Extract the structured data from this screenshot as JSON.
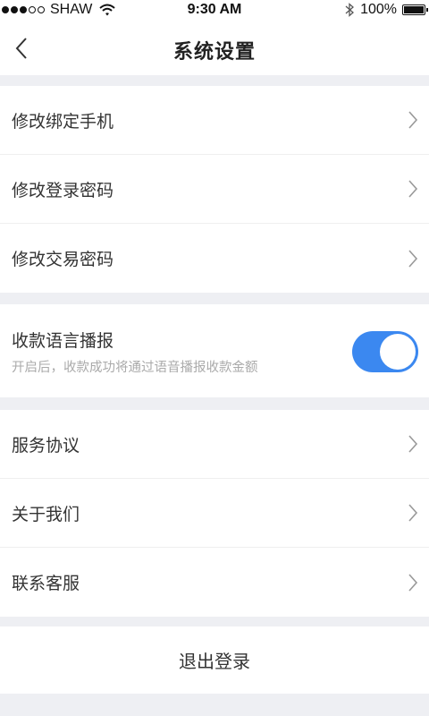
{
  "status_bar": {
    "carrier": "SHAW",
    "time": "9:30 AM",
    "battery": "100%",
    "signal_bars_filled": 3,
    "signal_bars_total": 5
  },
  "nav": {
    "title": "系统设置",
    "back_icon": "chevron-left-icon"
  },
  "group_account": {
    "items": [
      {
        "label": "修改绑定手机"
      },
      {
        "label": "修改登录密码"
      },
      {
        "label": "修改交易密码"
      }
    ]
  },
  "voice_broadcast": {
    "title": "收款语言播报",
    "description": "开启后，收款成功将通过语音播报收款金额",
    "enabled": true
  },
  "group_info": {
    "items": [
      {
        "label": "服务协议"
      },
      {
        "label": "关于我们"
      },
      {
        "label": "联系客服"
      }
    ]
  },
  "logout": {
    "label": "退出登录"
  },
  "colors": {
    "accent": "#3b88f0",
    "background": "#eeeff3",
    "text": "#333333",
    "subtext": "#aaaaaa"
  }
}
